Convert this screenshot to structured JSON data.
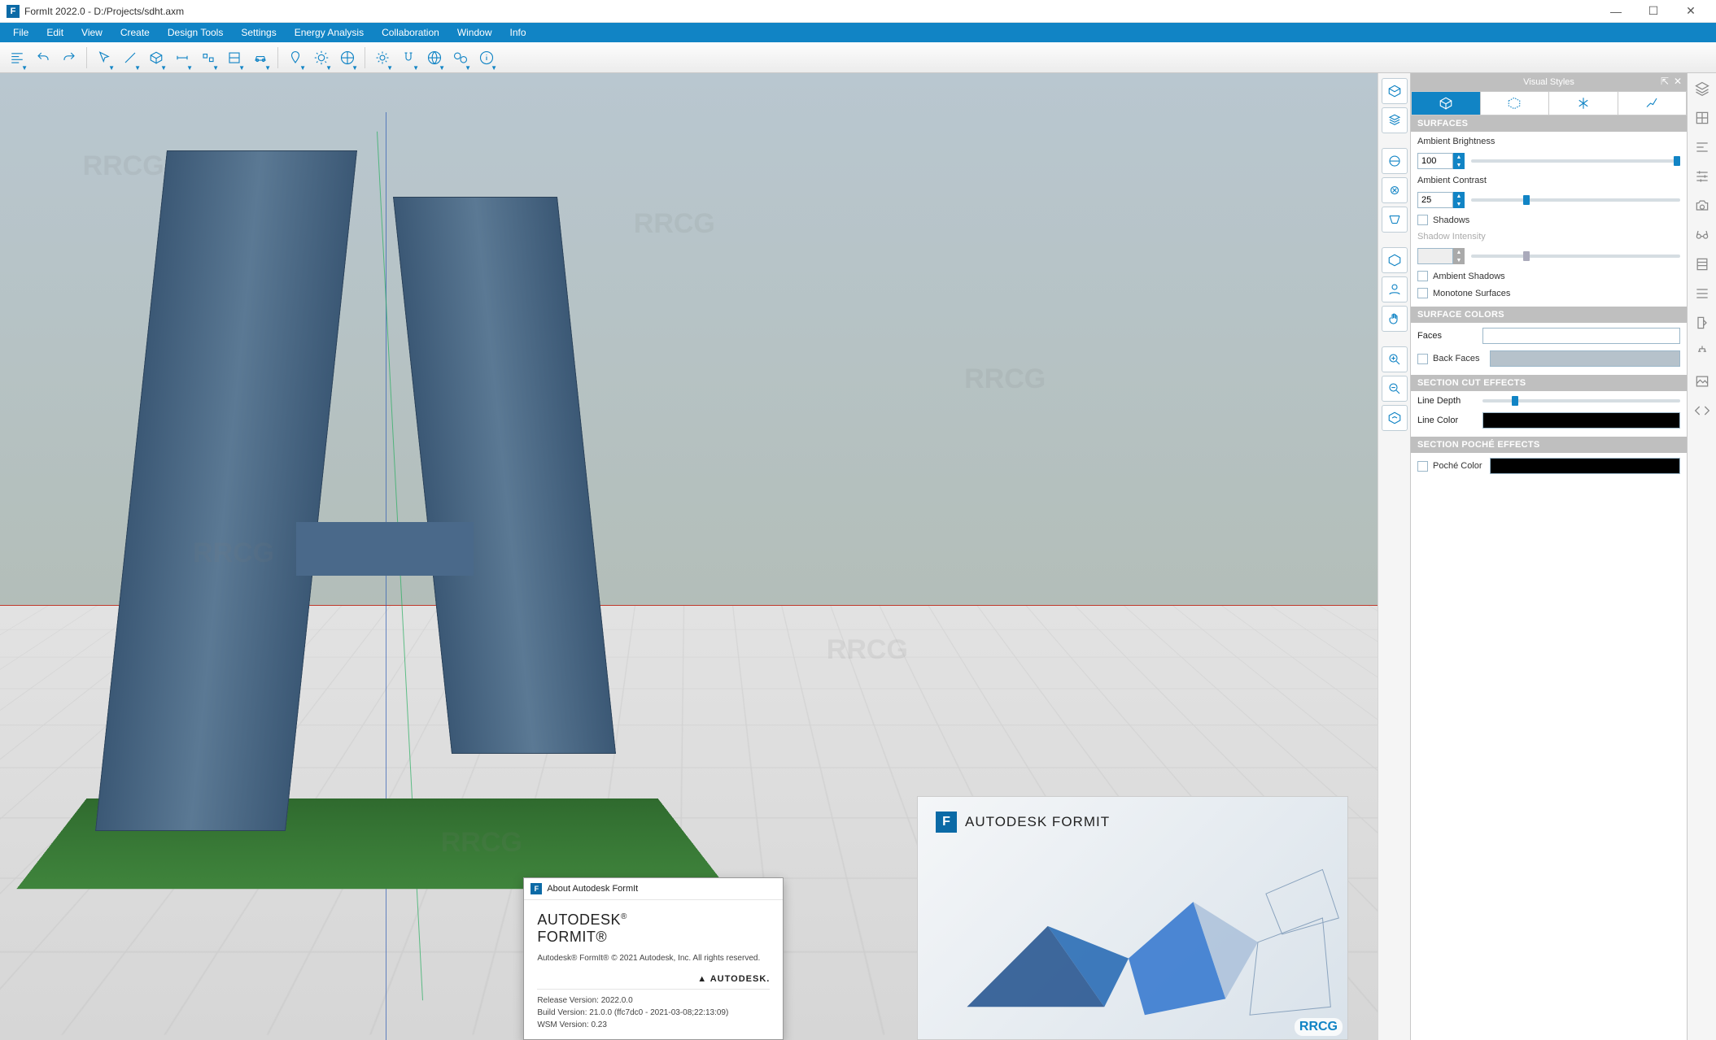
{
  "titlebar": {
    "logo": "F",
    "title": "FormIt 2022.0 - D:/Projects/sdht.axm"
  },
  "winctl": {
    "min": "—",
    "max": "☐",
    "close": "✕"
  },
  "menubar": [
    "File",
    "Edit",
    "View",
    "Create",
    "Design Tools",
    "Settings",
    "Energy Analysis",
    "Collaboration",
    "Window",
    "Info"
  ],
  "toolbar": [
    {
      "n": "align-left",
      "dd": true
    },
    {
      "n": "undo",
      "dd": false
    },
    {
      "n": "redo",
      "dd": false
    },
    {
      "sep": true
    },
    {
      "n": "pointer",
      "dd": true
    },
    {
      "n": "line",
      "dd": true
    },
    {
      "n": "cube",
      "dd": true
    },
    {
      "n": "dimension",
      "dd": true
    },
    {
      "n": "array",
      "dd": true
    },
    {
      "n": "section",
      "dd": true
    },
    {
      "n": "car",
      "dd": true
    },
    {
      "sep": true
    },
    {
      "n": "pin",
      "dd": true
    },
    {
      "n": "sun",
      "dd": true
    },
    {
      "n": "materials",
      "dd": true
    },
    {
      "sep": true
    },
    {
      "n": "gear",
      "dd": true
    },
    {
      "n": "snap",
      "dd": true
    },
    {
      "n": "globe",
      "dd": true
    },
    {
      "n": "compare",
      "dd": true
    },
    {
      "n": "info",
      "dd": true
    }
  ],
  "vtoolbar": [
    "view-3d",
    "view-iso",
    "_gap",
    "orbit",
    "look",
    "walk",
    "_gap",
    "3dview",
    "user",
    "hand",
    "_gap",
    "zoom-in",
    "zoom-out",
    "zoom-fit"
  ],
  "rightbar": [
    "layers",
    "mesh",
    "justify",
    "settings",
    "camera",
    "glasses",
    "bim",
    "levels",
    "swatch",
    "tree",
    "scene",
    "code"
  ],
  "visualStyles": {
    "title": "Visual Styles",
    "tabs": [
      "solid",
      "wire",
      "material",
      "settings"
    ],
    "surfaces": {
      "hdr": "SURFACES",
      "ambBrightLbl": "Ambient Brightness",
      "ambBright": "100",
      "ambBrightPct": 100,
      "ambContrastLbl": "Ambient Contrast",
      "ambContrast": "25",
      "ambContrastPct": 25,
      "shadows": "Shadows",
      "shadowIntLbl": "Shadow Intensity",
      "shadowInt": "",
      "shadowIntPct": 25,
      "ambShadows": "Ambient Shadows",
      "monotone": "Monotone Surfaces"
    },
    "surfaceColors": {
      "hdr": "SURFACE COLORS",
      "faces": "Faces",
      "facesColor": "#ffffff",
      "backFaces": "Back Faces",
      "backFacesColor": "#b6c2cb"
    },
    "sectionCut": {
      "hdr": "SECTION CUT EFFECTS",
      "lineDepth": "Line Depth",
      "lineDepthPct": 15,
      "lineColor": "Line Color",
      "lineColorVal": "#000000"
    },
    "poche": {
      "hdr": "SECTION POCHÉ EFFECTS",
      "pocheColor": "Poché Color",
      "pocheColorVal": "#000000"
    }
  },
  "about": {
    "hdr": "About Autodesk FormIt",
    "brand1": "AUTODESK",
    "brand2": "FORMIT",
    "copyright": "Autodesk® FormIt® © 2021 Autodesk, Inc.  All rights reserved.",
    "adlogo": "▲ AUTODESK.",
    "release": "Release Version: 2022.0.0",
    "build": "Build Version: 21.0.0 (ffc7dc0 - 2021-03-08;22:13:09)",
    "wsm": "WSM Version: 0.23"
  },
  "promo": {
    "logo": "F",
    "title": "AUTODESK  FORMIT",
    "badge": "RRCG"
  },
  "watermark": "RRCG"
}
